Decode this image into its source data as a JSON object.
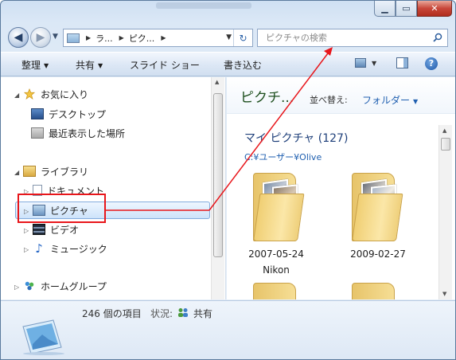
{
  "search": {
    "placeholder": "ピクチャの検索"
  },
  "address": {
    "crumbs": [
      "ラ...",
      "ピク..."
    ]
  },
  "toolbar": {
    "organize": "整理",
    "share": "共有",
    "slideshow": "スライド ショー",
    "burn": "書き込む"
  },
  "nav": {
    "favorites": "お気に入り",
    "desktop": "デスクトップ",
    "recent": "最近表示した場所",
    "libraries": "ライブラリ",
    "documents": "ドキュメント",
    "pictures": "ピクチャ",
    "videos": "ビデオ",
    "music": "ミュージック",
    "homegroup": "ホームグループ"
  },
  "content": {
    "title": "ピクチ...",
    "arrange_label": "並べ替え:",
    "arrange_value": "フォルダー",
    "library_title": "マイ ピクチャ (127)",
    "library_path": "C:¥ユーザー¥Olive",
    "folders": [
      {
        "name": "2007-05-24Nikon"
      },
      {
        "name": "2009-02-27"
      }
    ]
  },
  "details": {
    "count": "246 個の項目",
    "state_label": "状況:",
    "state_value": "共有"
  },
  "colors": {
    "annotation": "#e8161b",
    "accent_link": "#1f5fb0",
    "title_green": "#1e4f1e"
  }
}
